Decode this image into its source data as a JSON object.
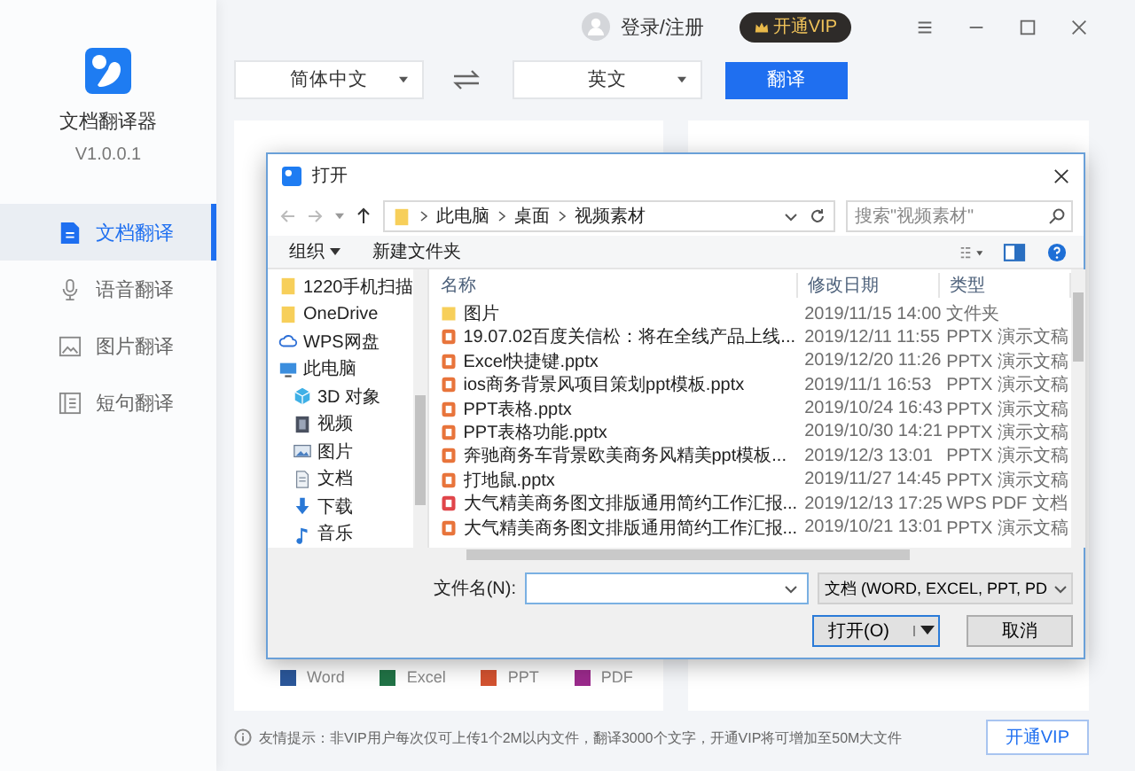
{
  "app": {
    "name": "文档翻译器",
    "version": "V1.0.0.1"
  },
  "sidebar": {
    "items": [
      {
        "label": "文档翻译",
        "kind": "document",
        "selected": true
      },
      {
        "label": "语音翻译",
        "kind": "microphone",
        "selected": false
      },
      {
        "label": "图片翻译",
        "kind": "image",
        "selected": false
      },
      {
        "label": "短句翻译",
        "kind": "text",
        "selected": false
      }
    ]
  },
  "top_bar": {
    "user_label": "登录/注册",
    "vip_button": "开通VIP"
  },
  "language_bar": {
    "source": "简体中文",
    "target": "英文",
    "translate_button": "翻译"
  },
  "formats": [
    {
      "label": "Word",
      "color": "#2b579a"
    },
    {
      "label": "Excel",
      "color": "#217346"
    },
    {
      "label": "PPT",
      "color": "#d35230"
    },
    {
      "label": "PDF",
      "color": "#9b2a8c"
    }
  ],
  "dialog": {
    "title": "打开",
    "path": [
      "此电脑",
      "桌面",
      "视频素材"
    ],
    "search_placeholder": "搜索\"视频素材\"",
    "toolbar": [
      "组织",
      "新建文件夹"
    ],
    "nav": [
      {
        "label": "1220手机扫描",
        "kind": "folder"
      },
      {
        "label": "OneDrive",
        "kind": "folder"
      },
      {
        "label": "WPS网盘",
        "kind": "cloud"
      },
      {
        "label": "此电脑",
        "kind": "computer",
        "children": [
          {
            "label": "3D 对象",
            "kind": "cube"
          },
          {
            "label": "视频",
            "kind": "video"
          },
          {
            "label": "图片",
            "kind": "image"
          },
          {
            "label": "文档",
            "kind": "document"
          },
          {
            "label": "下载",
            "kind": "download"
          },
          {
            "label": "音乐",
            "kind": "music"
          }
        ]
      }
    ],
    "columns": [
      "名称",
      "修改日期",
      "类型"
    ],
    "files": [
      {
        "name": "图片",
        "date": "2019/11/15 14:00",
        "type": "文件夹",
        "kind": "folder"
      },
      {
        "name": "19.07.02百度关信松：将在全线产品上线...",
        "date": "2019/12/11 11:55",
        "type": "PPTX 演示文稿",
        "kind": "pptx"
      },
      {
        "name": "Excel快捷键.pptx",
        "date": "2019/12/20 11:26",
        "type": "PPTX 演示文稿",
        "kind": "pptx"
      },
      {
        "name": "ios商务背景风项目策划ppt模板.pptx",
        "date": "2019/11/1 16:53",
        "type": "PPTX 演示文稿",
        "kind": "pptx"
      },
      {
        "name": "PPT表格.pptx",
        "date": "2019/10/24 16:43",
        "type": "PPTX 演示文稿",
        "kind": "pptx"
      },
      {
        "name": "PPT表格功能.pptx",
        "date": "2019/10/30 14:21",
        "type": "PPTX 演示文稿",
        "kind": "pptx"
      },
      {
        "name": "奔驰商务车背景欧美商务风精美ppt模板...",
        "date": "2019/12/3 13:01",
        "type": "PPTX 演示文稿",
        "kind": "pptx"
      },
      {
        "name": "打地鼠.pptx",
        "date": "2019/11/27 14:45",
        "type": "PPTX 演示文稿",
        "kind": "pptx"
      },
      {
        "name": "大气精美商务图文排版通用简约工作汇报...",
        "date": "2019/12/13 17:25",
        "type": "WPS PDF 文档",
        "kind": "pdf"
      },
      {
        "name": "大气精美商务图文排版通用简约工作汇报...",
        "date": "2019/10/21 13:01",
        "type": "PPTX 演示文稿",
        "kind": "pptx"
      }
    ],
    "filename_label": "文件名(N):",
    "filter": "文档 (WORD, EXCEL, PPT, PD",
    "open_button": "打开(O)",
    "cancel_button": "取消"
  },
  "footer": {
    "tip": "友情提示：非VIP用户每次仅可上传1个2M以内文件，翻译3000个文字，开通VIP将可增加至50M大文件",
    "vip_button": "开通VIP"
  }
}
